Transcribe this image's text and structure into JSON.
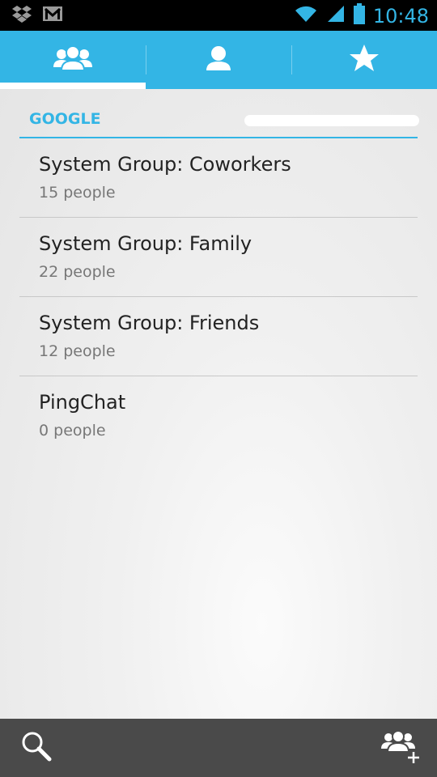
{
  "status_bar": {
    "time": "10:48",
    "icons": [
      "dropbox-icon",
      "gmail-icon",
      "wifi-icon",
      "signal-icon",
      "battery-icon"
    ]
  },
  "tabs": [
    {
      "name": "groups-tab-icon",
      "selected": true
    },
    {
      "name": "contacts-tab-icon",
      "selected": false
    },
    {
      "name": "favorites-tab-icon",
      "selected": false
    }
  ],
  "account": {
    "type": "GOOGLE",
    "email_redacted": true
  },
  "groups": [
    {
      "name": "System Group: Coworkers",
      "count": "15 people"
    },
    {
      "name": "System Group: Family",
      "count": "22 people"
    },
    {
      "name": "System Group: Friends",
      "count": "12 people"
    },
    {
      "name": "PingChat",
      "count": "0 people"
    }
  ],
  "bottom_bar": {
    "left_icon": "search-icon",
    "right_icon": "add-group-icon"
  },
  "colors": {
    "accent": "#33b5e5",
    "status_bar_bg": "#000000",
    "bottom_bar_bg": "#4a4a4a"
  }
}
